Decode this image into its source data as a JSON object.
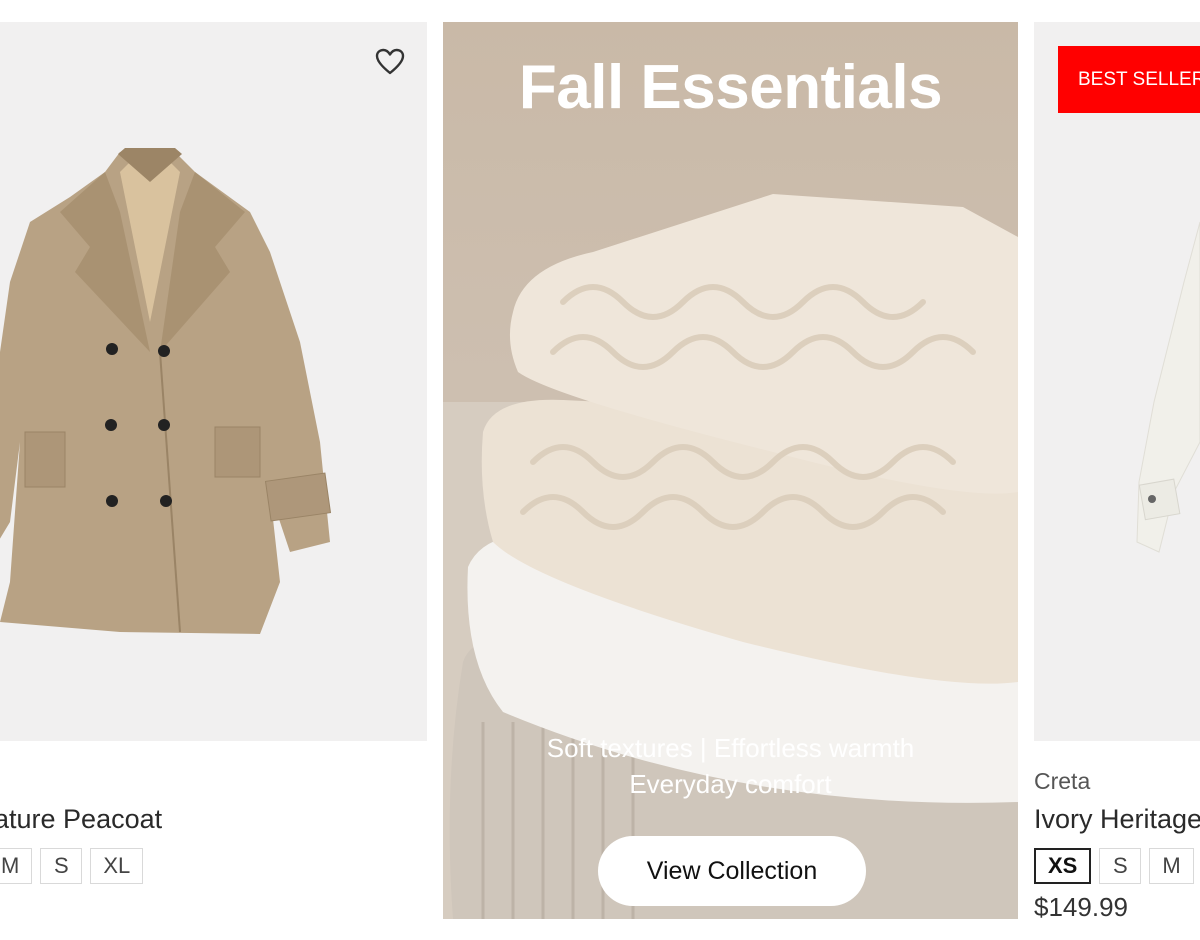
{
  "left_product": {
    "title": "ature Peacoat",
    "sizes": [
      "M",
      "S",
      "XL"
    ],
    "wishlist_icon": "heart-outline-icon"
  },
  "banner": {
    "title": "Fall Essentials",
    "subtitle_line1": "Soft textures | Effortless warmth",
    "subtitle_line2": "Everyday comfort",
    "button_label": "View Collection"
  },
  "right_product": {
    "badge": "BEST SELLER",
    "brand": "Creta",
    "title": "Ivory Heritage",
    "sizes": [
      "XS",
      "S",
      "M"
    ],
    "selected_size": "XS",
    "price": "$149.99"
  },
  "colors": {
    "badge_red": "#ff0000",
    "card_bg": "#f1f0f0",
    "banner_bg": "#c9b9a7"
  }
}
